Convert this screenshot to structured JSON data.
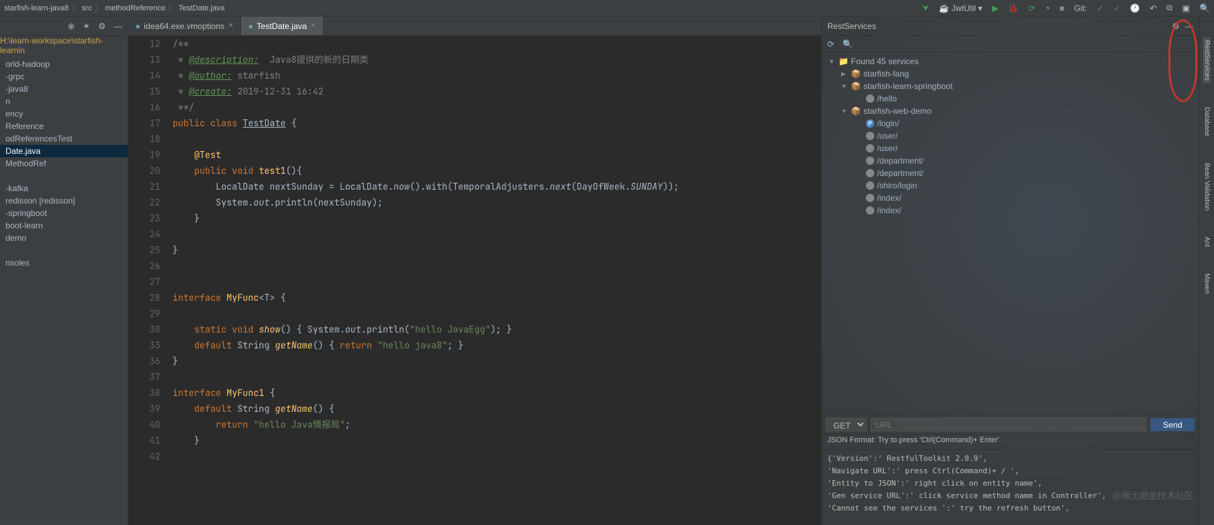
{
  "breadcrumb": {
    "p1": "starfish-learn-java8",
    "p2": "src",
    "p3": "methodReference",
    "p4": "TestDate.java"
  },
  "topRight": {
    "runConfig": "JwtUtil",
    "git": "Git:"
  },
  "leftTree": {
    "path": "H:\\learn-workspace\\starfish-learnin",
    "items": [
      "orld-hadoop",
      "-grpc",
      "-java8",
      "n",
      "ency",
      "Reference",
      "odReferencesTest",
      "Date.java",
      "MethodRef",
      "",
      "-kafka",
      "redisson [redisson]",
      "-springboot",
      "boot-learn",
      "demo",
      "",
      "nsoles"
    ],
    "selectedIndex": 7
  },
  "tabs": [
    {
      "label": "idea64.exe.vmoptions",
      "active": false
    },
    {
      "label": "TestDate.java",
      "active": true
    }
  ],
  "code": {
    "startLine": 12,
    "lines": [
      {
        "n": "12",
        "html": "<span class='com'>/**</span>"
      },
      {
        "n": "13",
        "html": "<span class='com'> * </span><span class='tag'>@description:</span><span class='com'>  Java8提供的新的日期类</span>"
      },
      {
        "n": "14",
        "html": "<span class='com'> * </span><span class='tag'>@author:</span><span class='com'> starfish</span>"
      },
      {
        "n": "15",
        "html": "<span class='com'> * </span><span class='tag'>@create:</span><span class='com'> 2019-12-31 16:42</span>"
      },
      {
        "n": "16",
        "html": "<span class='com'> **/</span>"
      },
      {
        "n": "17",
        "html": "<span class='kw'>public class </span><span class='cls'>TestDate</span> {"
      },
      {
        "n": "18",
        "html": ""
      },
      {
        "n": "19",
        "html": "    <span class='fn'>@Test</span>"
      },
      {
        "n": "20",
        "html": "    <span class='kw'>public void </span><span class='fn'>test1</span>(){"
      },
      {
        "n": "21",
        "html": "        LocalDate nextSunday = LocalDate.<span class='it'>now</span>().with(TemporalAdjusters.<span class='it'>next</span>(DayOfWeek.<span class='it'>SUNDAY</span>));"
      },
      {
        "n": "22",
        "html": "        System.<span class='it'>out</span>.println(nextSunday);"
      },
      {
        "n": "23",
        "html": "    }"
      },
      {
        "n": "24",
        "html": ""
      },
      {
        "n": "25",
        "html": "}"
      },
      {
        "n": "26",
        "html": ""
      },
      {
        "n": "27",
        "html": ""
      },
      {
        "n": "28",
        "html": "<span class='kw'>interface </span><span class='fn'>MyFunc</span>&lt;T&gt; {"
      },
      {
        "n": "29",
        "html": ""
      },
      {
        "n": "30",
        "html": "    <span class='kw'>static void </span><span class='fni'>show</span>() { System.<span class='it'>out</span>.println(<span class='str'>\"hello JavaEgg\"</span>); }"
      },
      {
        "n": "33",
        "html": "    <span class='kw'>default </span>String <span class='fni'>getName</span>() { <span class='kw'>return </span><span class='str'>\"hello java8\"</span>; }"
      },
      {
        "n": "36",
        "html": "}"
      },
      {
        "n": "37",
        "html": ""
      },
      {
        "n": "38",
        "html": "<span class='kw'>interface </span><span class='fn'>MyFunc1</span> {"
      },
      {
        "n": "39",
        "html": "    <span class='kw'>default </span>String <span class='fni'>getName</span>() {"
      },
      {
        "n": "40",
        "html": "        <span class='kw'>return </span><span class='str'>\"hello Java情报局\"</span>;"
      },
      {
        "n": "41",
        "html": "    }"
      },
      {
        "n": "42",
        "html": ""
      }
    ]
  },
  "rest": {
    "title": "RestServices",
    "found": "Found 45 services",
    "projects": [
      {
        "name": "starfish-fang",
        "expanded": false
      },
      {
        "name": "starfish-learn-springboot",
        "expanded": true,
        "endpoints": [
          {
            "p": "/hello",
            "m": "g"
          }
        ]
      },
      {
        "name": "starfish-web-demo",
        "expanded": true,
        "endpoints": [
          {
            "p": "/login/",
            "m": "p"
          },
          {
            "p": "/user/",
            "m": "g"
          },
          {
            "p": "/user/",
            "m": "g"
          },
          {
            "p": "/department/",
            "m": "g"
          },
          {
            "p": "/department/",
            "m": "g"
          },
          {
            "p": "/shiro/login",
            "m": "g"
          },
          {
            "p": "/index/",
            "m": "g"
          },
          {
            "p": "/index/",
            "m": "g"
          }
        ]
      }
    ],
    "method": "GET",
    "urlPlaceholder": "URL",
    "send": "Send",
    "jsonHint": "JSON Format: Try to press 'Ctrl(Command)+ Enter'",
    "output": [
      "{'Version':' RestfulToolkit 2.0.9',",
      "'Navigate URL':' press Ctrl(Command)+ / ',",
      "'Entity to JSON':' right click on entity name',",
      "'Gen service URL':' click service method name in Controller',",
      "'Cannot see the services ':' try the refresh button',"
    ]
  },
  "rightDock": [
    "RestServices",
    "Database",
    "Bean Validation",
    "Ant",
    "Maven"
  ],
  "watermark": "@稀土掘金技术社区"
}
